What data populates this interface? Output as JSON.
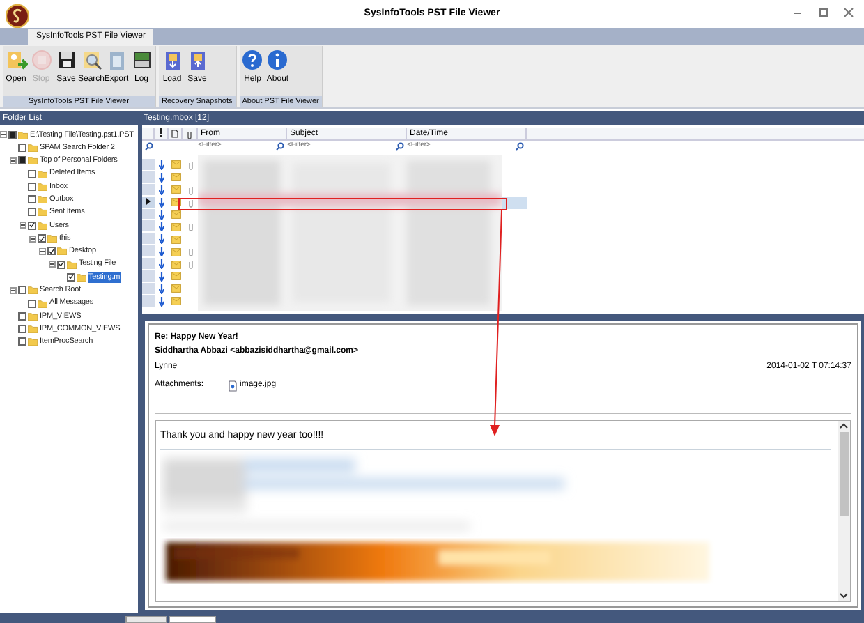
{
  "window": {
    "title": "SysInfoTools PST File Viewer"
  },
  "ribbon": {
    "tabs": [
      {
        "label": "SysInfoTools PST File Viewer",
        "selected": true
      }
    ],
    "groups": [
      {
        "label": "SysInfoTools PST File Viewer",
        "buttons": [
          {
            "label": "Open",
            "disabled": false
          },
          {
            "label": "Stop",
            "disabled": true
          },
          {
            "label": "Save",
            "disabled": false
          },
          {
            "label": "Search",
            "disabled": false
          },
          {
            "label": "Export",
            "disabled": false
          },
          {
            "label": "Log",
            "disabled": false
          }
        ]
      },
      {
        "label": "Recovery Snapshots",
        "buttons": [
          {
            "label": "Load",
            "disabled": false
          },
          {
            "label": "Save",
            "disabled": false
          }
        ]
      },
      {
        "label": "About PST File Viewer",
        "buttons": [
          {
            "label": "Help",
            "disabled": false
          },
          {
            "label": "About",
            "disabled": false
          }
        ]
      }
    ]
  },
  "folder_pane": {
    "title": "Folder List",
    "tree": [
      {
        "label": "E:\\Testing File\\Testing.pst1.PST",
        "checked": false,
        "partial": true,
        "expanded": true,
        "selected": false,
        "children": [
          {
            "label": "SPAM Search Folder 2",
            "checked": false,
            "partial": false,
            "selected": false
          },
          {
            "label": "Top of Personal Folders",
            "checked": false,
            "partial": true,
            "expanded": true,
            "selected": false,
            "children": [
              {
                "label": "Deleted Items",
                "checked": false,
                "partial": false,
                "selected": false
              },
              {
                "label": "Inbox",
                "checked": false,
                "partial": false,
                "selected": false
              },
              {
                "label": "Outbox",
                "checked": false,
                "partial": false,
                "selected": false
              },
              {
                "label": "Sent Items",
                "checked": false,
                "partial": false,
                "selected": false
              },
              {
                "label": "Users",
                "checked": true,
                "partial": false,
                "expanded": true,
                "selected": false,
                "children": [
                  {
                    "label": "this",
                    "checked": true,
                    "partial": false,
                    "expanded": true,
                    "selected": false,
                    "children": [
                      {
                        "label": "Desktop",
                        "checked": true,
                        "partial": false,
                        "expanded": true,
                        "selected": false,
                        "children": [
                          {
                            "label": "Testing File",
                            "checked": true,
                            "partial": false,
                            "expanded": true,
                            "selected": false,
                            "children": [
                              {
                                "label": "Testing.m",
                                "checked": true,
                                "partial": false,
                                "selected": true
                              }
                            ]
                          }
                        ]
                      }
                    ]
                  }
                ]
              }
            ]
          },
          {
            "label": "Search Root",
            "checked": false,
            "partial": false,
            "expanded": true,
            "selected": false,
            "children": [
              {
                "label": "All Messages",
                "checked": false,
                "partial": false,
                "selected": false
              }
            ]
          },
          {
            "label": "IPM_VIEWS",
            "checked": false,
            "partial": false,
            "selected": false
          },
          {
            "label": "IPM_COMMON_VIEWS",
            "checked": false,
            "partial": false,
            "selected": false
          },
          {
            "label": "ItemProcSearch",
            "checked": false,
            "partial": false,
            "selected": false
          }
        ]
      }
    ]
  },
  "message_list": {
    "title": "Testing.mbox [12]",
    "columns": [
      {
        "label": "From",
        "placeholder": "<Filter>"
      },
      {
        "label": "Subject",
        "placeholder": "<Filter>"
      },
      {
        "label": "Date/Time",
        "placeholder": "<Filter>"
      }
    ],
    "rows": [
      {
        "attachment": true,
        "selected": false
      },
      {
        "attachment": false,
        "selected": false
      },
      {
        "attachment": true,
        "selected": false
      },
      {
        "attachment": true,
        "selected": true
      },
      {
        "attachment": false,
        "selected": false
      },
      {
        "attachment": true,
        "selected": false
      },
      {
        "attachment": false,
        "selected": false
      },
      {
        "attachment": true,
        "selected": false
      },
      {
        "attachment": true,
        "selected": false
      },
      {
        "attachment": false,
        "selected": false
      },
      {
        "attachment": false,
        "selected": false
      },
      {
        "attachment": false,
        "selected": false
      }
    ]
  },
  "preview": {
    "subject": "Re: Happy New Year!",
    "from": "Siddhartha Abbazi <abbazisiddhartha@gmail.com>",
    "to": "Lynne",
    "date": "2014-01-02 T 07:14:37",
    "attachments_label": "Attachments:",
    "attachments": [
      "image.jpg"
    ],
    "body": "Thank you and happy new year too!!!!"
  }
}
